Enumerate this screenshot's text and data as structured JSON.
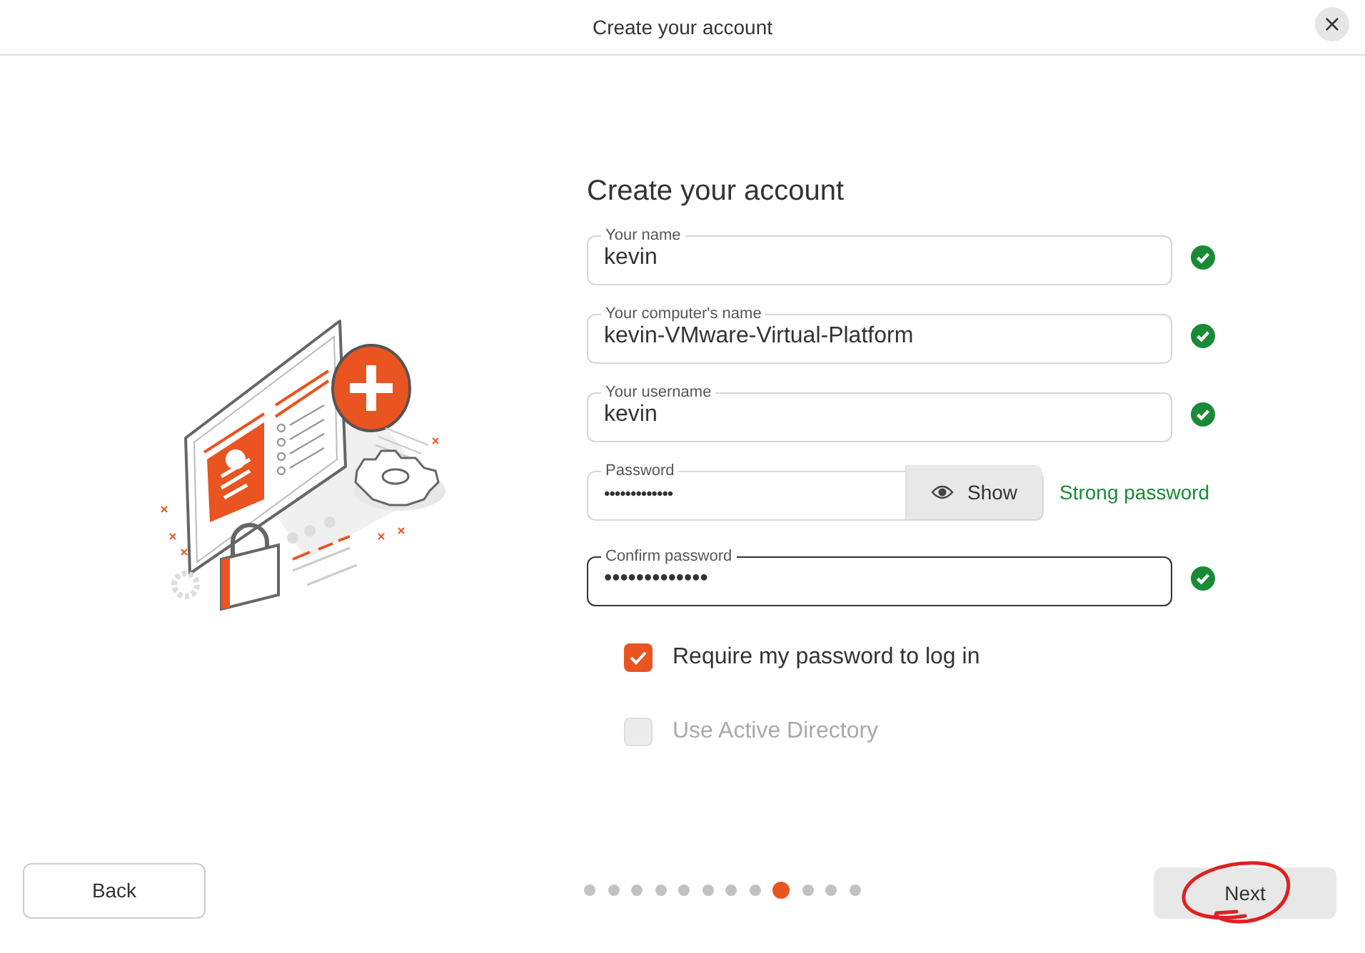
{
  "window": {
    "title": "Create your account",
    "close_button": "×"
  },
  "form": {
    "heading": "Create your account",
    "fields": [
      {
        "kind": "text",
        "label": "Your name",
        "value": "kevin",
        "valid": true,
        "focused": false
      },
      {
        "kind": "text",
        "label": "Your computer's name",
        "value": "kevin-VMware-Virtual-Platform",
        "valid": true,
        "focused": false
      },
      {
        "kind": "text",
        "label": "Your username",
        "value": "kevin",
        "valid": true,
        "focused": false
      },
      {
        "kind": "password",
        "label": "Password",
        "value": "•••••••••••••",
        "show_button": "Show",
        "strength": "Strong password",
        "focused": false
      },
      {
        "kind": "text",
        "label": "Confirm password",
        "value": "•••••••••••••",
        "valid": true,
        "focused": true
      }
    ],
    "checkboxes": [
      {
        "label": "Require my password to log in",
        "checked": true,
        "disabled": false
      },
      {
        "label": "Use Active Directory",
        "checked": false,
        "disabled": true
      }
    ]
  },
  "footer": {
    "back_button": "Back",
    "steps": [
      {
        "selected": false
      },
      {
        "selected": false
      },
      {
        "selected": false
      },
      {
        "selected": false
      },
      {
        "selected": false
      },
      {
        "selected": false
      },
      {
        "selected": false
      },
      {
        "selected": false
      },
      {
        "selected": true
      },
      {
        "selected": false
      },
      {
        "selected": false
      },
      {
        "selected": false
      }
    ],
    "next_button": {
      "label": "Next",
      "circled": true
    }
  }
}
